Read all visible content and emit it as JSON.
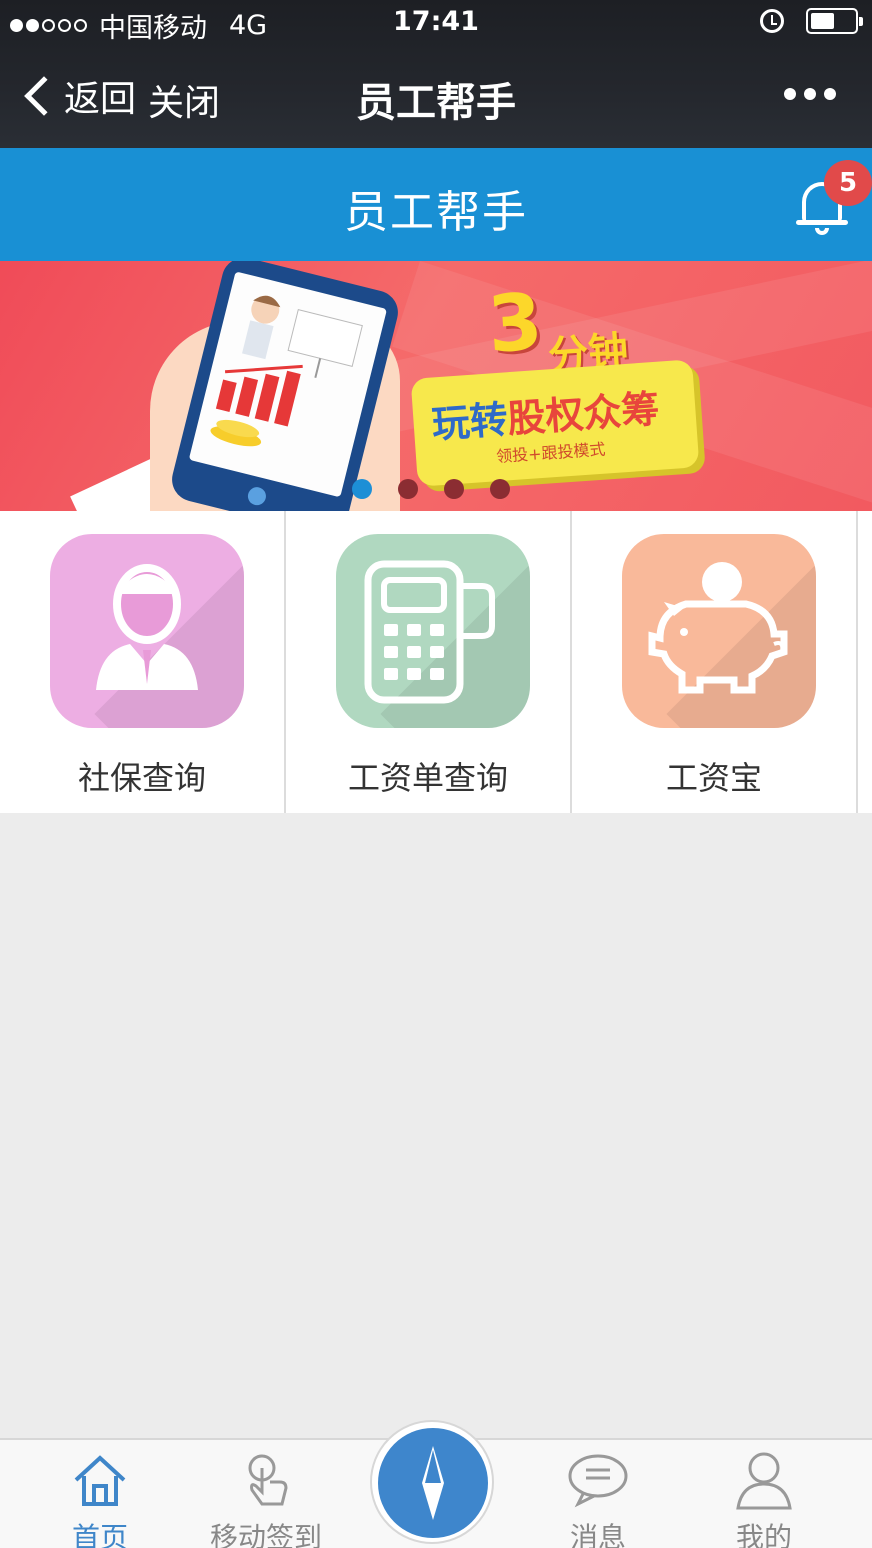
{
  "status_bar": {
    "carrier": "中国移动",
    "network": "4G",
    "time": "17:41"
  },
  "wechat_nav": {
    "back_label": "返回",
    "close_label": "关闭",
    "title": "员工帮手"
  },
  "app_header": {
    "title": "员工帮手",
    "notification_count": "5"
  },
  "banner": {
    "headline_number": "3",
    "headline_unit": "分钟",
    "main_text_blue": "玩转",
    "main_text_red": "股权众筹",
    "sub_text": "领投+跟投模式",
    "slide_count": 4,
    "active_slide": 1
  },
  "services": [
    {
      "label": "社保查询",
      "icon": "person-icon",
      "color": "#edaee3"
    },
    {
      "label": "工资单查询",
      "icon": "pos-terminal-icon",
      "color": "#b0d8c0"
    },
    {
      "label": "工资宝",
      "icon": "piggy-bank-icon",
      "color": "#f9b99a"
    }
  ],
  "tabbar": {
    "items": [
      {
        "label": "首页",
        "icon": "home-icon",
        "active": true
      },
      {
        "label": "移动签到",
        "icon": "tap-hand-icon",
        "active": false
      },
      {
        "label": "",
        "icon": "compass-icon",
        "active": false
      },
      {
        "label": "消息",
        "icon": "chat-bubble-icon",
        "active": false
      },
      {
        "label": "我的",
        "icon": "user-icon",
        "active": false
      }
    ]
  },
  "colors": {
    "header_blue": "#1990d4",
    "badge_red": "#e14a4a",
    "tab_active": "#3f86c9",
    "center_button": "#3e86cc"
  }
}
